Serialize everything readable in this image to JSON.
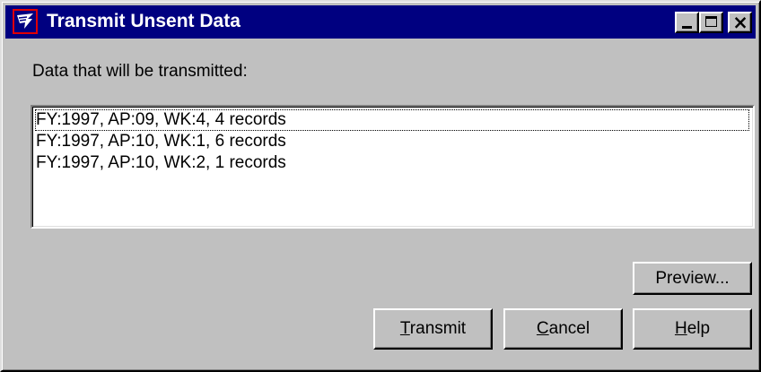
{
  "window": {
    "title": "Transmit Unsent Data"
  },
  "titlebar_buttons": {
    "minimize": "minimize",
    "maximize": "maximize",
    "close": "close"
  },
  "dialog": {
    "label": "Data that will be transmitted:",
    "items": [
      "FY:1997, AP:09, WK:4, 4 records",
      "FY:1997, AP:10, WK:1, 6 records",
      "FY:1997, AP:10, WK:2, 1 records"
    ],
    "focused_index": 0
  },
  "buttons": {
    "preview": "Preview...",
    "transmit": {
      "accel": "T",
      "rest": "ransmit"
    },
    "cancel": {
      "accel": "C",
      "rest": "ancel"
    },
    "help": {
      "accel": "H",
      "rest": "elp"
    }
  },
  "colors": {
    "titlebar": "#000080",
    "face": "#c0c0c0",
    "icon_border": "#e00000"
  },
  "icons": {
    "app": "eagle-logo-icon"
  }
}
